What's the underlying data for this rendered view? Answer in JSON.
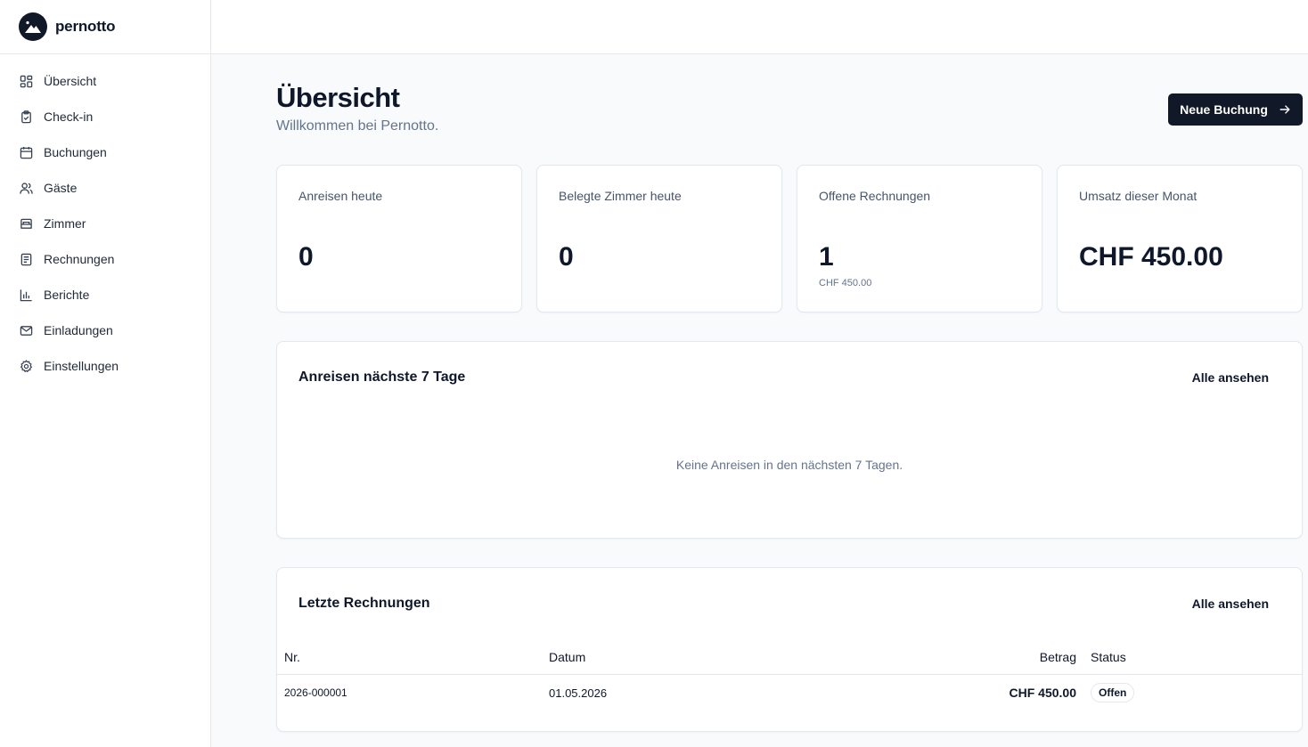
{
  "brand": {
    "name": "pernotto",
    "logo_icon": "mountain-icon"
  },
  "sidebar": {
    "items": [
      {
        "label": "Übersicht",
        "icon": "grid-icon"
      },
      {
        "label": "Check-in",
        "icon": "clipboard-check-icon"
      },
      {
        "label": "Buchungen",
        "icon": "calendar-icon"
      },
      {
        "label": "Gäste",
        "icon": "users-icon"
      },
      {
        "label": "Zimmer",
        "icon": "bed-icon"
      },
      {
        "label": "Rechnungen",
        "icon": "receipt-icon"
      },
      {
        "label": "Berichte",
        "icon": "bar-chart-icon"
      },
      {
        "label": "Einladungen",
        "icon": "mail-icon"
      },
      {
        "label": "Einstellungen",
        "icon": "gear-icon"
      }
    ]
  },
  "header": {
    "title": "Übersicht",
    "subtitle": "Willkommen bei Pernotto.",
    "new_booking_label": "Neue Buchung"
  },
  "stats": [
    {
      "label": "Anreisen heute",
      "value": "0",
      "sub": ""
    },
    {
      "label": "Belegte Zimmer heute",
      "value": "0",
      "sub": ""
    },
    {
      "label": "Offene Rechnungen",
      "value": "1",
      "sub": "CHF 450.00"
    },
    {
      "label": "Umsatz dieser Monat",
      "value": "CHF 450.00",
      "sub": ""
    }
  ],
  "arrivals": {
    "title": "Anreisen nächste 7 Tage",
    "link": "Alle ansehen",
    "empty": "Keine Anreisen in den nächsten 7 Tagen."
  },
  "invoices": {
    "title": "Letzte Rechnungen",
    "link": "Alle ansehen",
    "columns": {
      "nr": "Nr.",
      "datum": "Datum",
      "betrag": "Betrag",
      "status": "Status"
    },
    "rows": [
      {
        "nr": "2026-000001",
        "datum": "01.05.2026",
        "betrag": "CHF 450.00",
        "status": "Offen"
      }
    ]
  },
  "colors": {
    "accent": "#111827",
    "muted": "#64748b",
    "border": "#e2e8f0"
  }
}
